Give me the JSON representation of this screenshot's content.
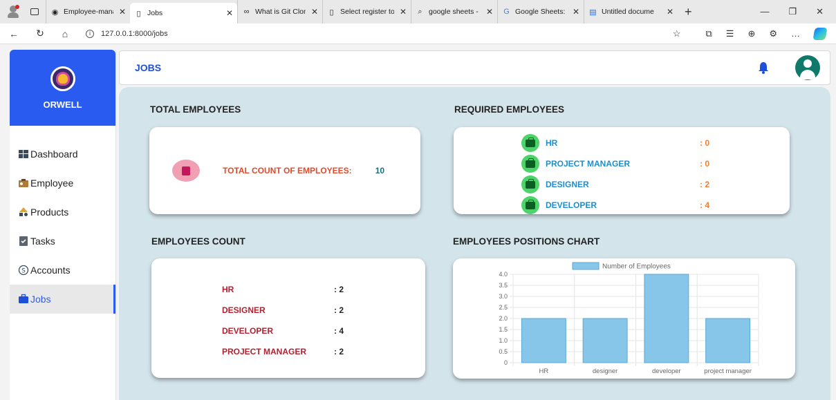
{
  "browser": {
    "tabs": [
      {
        "label": "Employee-manag",
        "icon": "github-icon"
      },
      {
        "label": "Jobs",
        "icon": "page-icon",
        "active": true
      },
      {
        "label": "What is Git Clone",
        "icon": "link-icon"
      },
      {
        "label": "Select register to",
        "icon": "page-icon"
      },
      {
        "label": "google sheets - S",
        "icon": "search-icon"
      },
      {
        "label": "Google Sheets: O",
        "icon": "google-icon"
      },
      {
        "label": "Untitled docume",
        "icon": "docs-icon"
      }
    ],
    "url": "127.0.0.1:8000/jobs"
  },
  "sidebar": {
    "brand": "ORWELL",
    "items": [
      {
        "label": "Dashboard",
        "icon": "dashboard-icon"
      },
      {
        "label": "Employee",
        "icon": "employee-icon"
      },
      {
        "label": "Products",
        "icon": "products-icon"
      },
      {
        "label": "Tasks",
        "icon": "tasks-icon"
      },
      {
        "label": "Accounts",
        "icon": "accounts-icon"
      },
      {
        "label": "Jobs",
        "icon": "briefcase-icon",
        "active": true
      }
    ]
  },
  "header": {
    "title": "JOBS"
  },
  "sections": {
    "total": "TOTAL EMPLOYEES",
    "required": "REQUIRED EMPLOYEES",
    "count": "EMPLOYEES COUNT",
    "chart": "EMPLOYEES POSITIONS CHART"
  },
  "total_card": {
    "label": "TOTAL COUNT OF EMPLOYEES:",
    "value": "10"
  },
  "required": [
    {
      "name": "HR",
      "value": ": 0"
    },
    {
      "name": "PROJECT MANAGER",
      "value": ": 0"
    },
    {
      "name": "DESIGNER",
      "value": ": 2"
    },
    {
      "name": "DEVELOPER",
      "value": ": 4"
    }
  ],
  "counts": [
    {
      "name": "HR",
      "value": ": 2"
    },
    {
      "name": "DESIGNER",
      "value": ": 2"
    },
    {
      "name": "DEVELOPER",
      "value": ": 4"
    },
    {
      "name": "PROJECT MANAGER",
      "value": ": 2"
    }
  ],
  "colors": {
    "accent": "#2a5bf0",
    "bar": "#87c6e8",
    "bar_border": "#5aa9d6",
    "main_bg": "#d3e4ea"
  },
  "chart_data": {
    "type": "bar",
    "categories": [
      "HR",
      "designer",
      "developer",
      "project manager"
    ],
    "series": [
      {
        "name": "Number of Employees",
        "values": [
          2,
          2,
          4,
          2
        ]
      }
    ],
    "ylim": [
      0,
      4
    ],
    "yticks": [
      "0",
      "0.5",
      "1.0",
      "1.5",
      "2.0",
      "2.5",
      "3.0",
      "3.5",
      "4.0"
    ],
    "legend": "top-center",
    "grid": true
  }
}
